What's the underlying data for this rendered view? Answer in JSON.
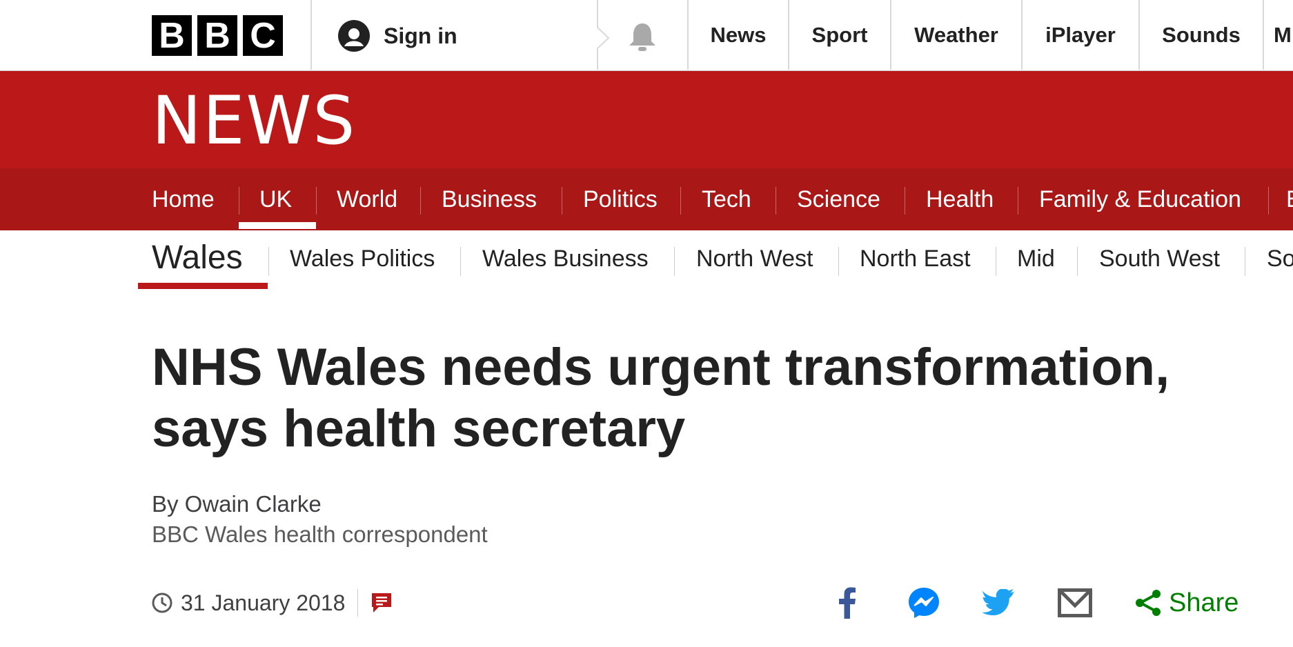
{
  "brand": {
    "letters": [
      "B",
      "B",
      "C"
    ]
  },
  "topbar": {
    "signin_label": "Sign in",
    "nav": [
      "News",
      "Sport",
      "Weather",
      "iPlayer",
      "Sounds",
      "M"
    ]
  },
  "banner": {
    "wordmark": "NEWS"
  },
  "section_nav": {
    "items": [
      "Home",
      "UK",
      "World",
      "Business",
      "Politics",
      "Tech",
      "Science",
      "Health",
      "Family & Education",
      "E"
    ],
    "active": "UK"
  },
  "sub_nav": {
    "title": "Wales",
    "items": [
      "Wales Politics",
      "Wales Business",
      "North West",
      "North East",
      "Mid",
      "South West",
      "So"
    ]
  },
  "article": {
    "headline_line1": "NHS Wales needs urgent transformation,",
    "headline_line2": "says health secretary",
    "author": "By Owain Clarke",
    "author_role": "BBC Wales health correspondent",
    "date": "31 January 2018"
  },
  "share": {
    "label": "Share",
    "icons": [
      "facebook-icon",
      "messenger-icon",
      "twitter-icon",
      "email-icon",
      "share-icon"
    ]
  },
  "colors": {
    "banner_red": "#bb1919",
    "nav_red": "#a91717",
    "facebook": "#3b5998",
    "messenger": "#0084ff",
    "twitter": "#1da1f2",
    "share_green": "#007f00"
  }
}
